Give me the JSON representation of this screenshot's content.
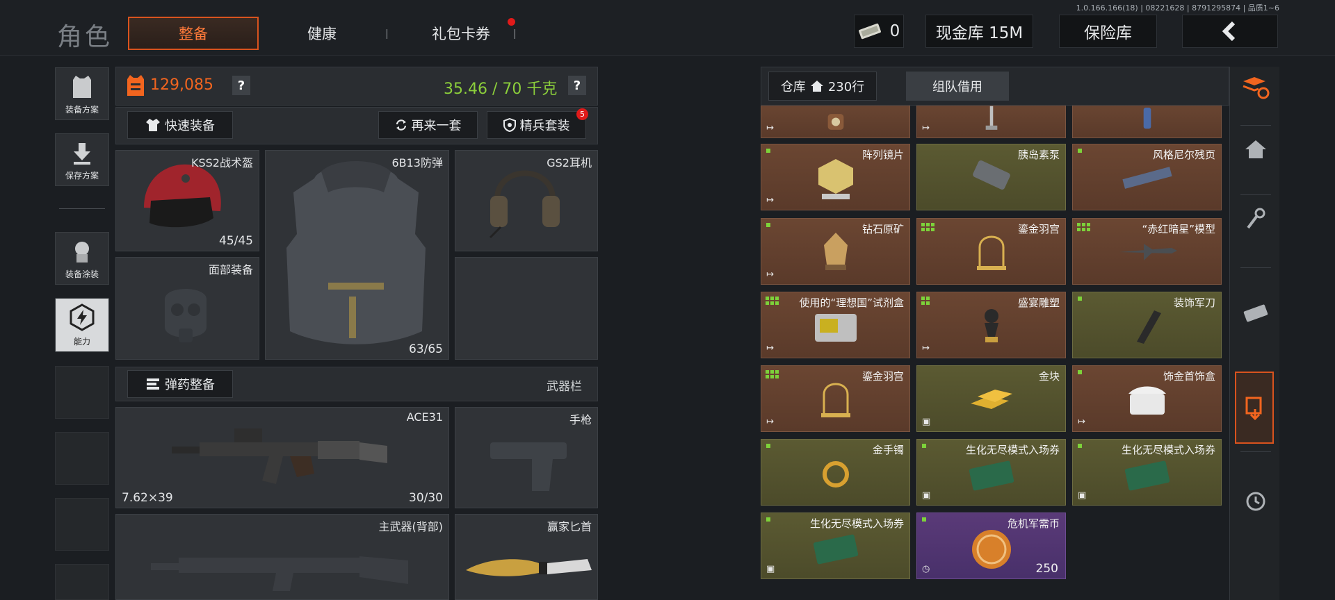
{
  "version": "1.0.166.166(18) | 08221628 | 8791295874 | 品质1~6",
  "header": {
    "title": "角色",
    "tabs": [
      {
        "label": "整备",
        "active": true
      },
      {
        "label": "健康",
        "active": false
      },
      {
        "label": "礼包卡券",
        "active": false,
        "badge": true
      }
    ],
    "currency_value": "0",
    "cash_vault": "现金库 15M",
    "insurance": "保险库",
    "back_icon": "chevron-left-icon"
  },
  "left_nav": [
    {
      "label": "装备方案",
      "icon": "vest-icon"
    },
    {
      "label": "保存方案",
      "icon": "download-icon"
    },
    {
      "label": "装备涂装",
      "icon": "skin-icon"
    },
    {
      "label": "能力",
      "icon": "ability-icon",
      "active": true
    }
  ],
  "stats": {
    "value": "129,085",
    "weight": "35.46 / 70 千克",
    "help": "?"
  },
  "actions": {
    "quick_equip": "快速装备",
    "again": "再来一套",
    "elite": "精兵套装",
    "elite_badge": "5"
  },
  "gear": {
    "helmet": {
      "label": "KSS2战术盔",
      "count": "45/45"
    },
    "armor": {
      "label": "6B13防弹",
      "count": "63/65"
    },
    "headset": {
      "label": "GS2耳机"
    },
    "face": {
      "label": "面部装备"
    }
  },
  "weapons": {
    "ammo_btn": "弹药整备",
    "section_label": "武器栏",
    "primary": {
      "label": "ACE31",
      "caliber": "7.62×39",
      "count": "30/30"
    },
    "pistol": {
      "label": "手枪"
    },
    "back_weapon": {
      "label": "主武器(背部)"
    },
    "knife": {
      "label": "赢家匕首"
    }
  },
  "storage": {
    "tab_vault": "仓库",
    "vault_rows": "230行",
    "tab_team": "组队借用",
    "items": [
      {
        "name": "",
        "color": "brown",
        "exit": true,
        "art": "clock-icon"
      },
      {
        "name": "",
        "color": "brown",
        "exit": true,
        "art": "lamp-icon"
      },
      {
        "name": "",
        "color": "brown",
        "exit": false,
        "art": "bottle-icon"
      },
      {
        "name": "阵列镜片",
        "color": "brown",
        "marker": "sq",
        "exit": true,
        "art": "lens-icon"
      },
      {
        "name": "胰岛素泵",
        "color": "olive",
        "marker": "",
        "exit": false,
        "art": "pump-icon"
      },
      {
        "name": "风格尼尔残页",
        "color": "brown",
        "marker": "sq",
        "exit": false,
        "art": "scroll-icon"
      },
      {
        "name": "钻石原矿",
        "color": "brown",
        "marker": "sq",
        "exit": true,
        "art": "ore-icon"
      },
      {
        "name": "鎏金羽宫",
        "color": "brown",
        "marker": "grid6",
        "exit": false,
        "art": "cage-icon"
      },
      {
        "name": "“赤红暗星”模型",
        "color": "brown",
        "marker": "grid6",
        "exit": false,
        "art": "jet-icon"
      },
      {
        "name": "使用的“理想国”试剂盒",
        "color": "brown",
        "marker": "grid6",
        "exit": true,
        "art": "kit-icon"
      },
      {
        "name": "盛宴雕塑",
        "color": "brown",
        "marker": "grid4",
        "exit": true,
        "art": "bust-icon"
      },
      {
        "name": "装饰军刀",
        "color": "olive",
        "marker": "sq",
        "exit": false,
        "art": "blade-icon"
      },
      {
        "name": "鎏金羽宫",
        "color": "brown",
        "marker": "grid6",
        "exit": true,
        "art": "cage-icon"
      },
      {
        "name": "金块",
        "color": "olive",
        "marker": "",
        "exit": false,
        "box": true,
        "art": "gold-icon"
      },
      {
        "name": "饰金首饰盒",
        "color": "brown",
        "marker": "sq",
        "exit": true,
        "art": "jewelry-box-icon"
      },
      {
        "name": "金手镯",
        "color": "olive",
        "marker": "sq",
        "exit": false,
        "art": "bracelet-icon"
      },
      {
        "name": "生化无尽模式入场券",
        "color": "olive",
        "marker": "sq",
        "exit": false,
        "box": true,
        "art": "ticket-icon"
      },
      {
        "name": "生化无尽模式入场券",
        "color": "olive",
        "marker": "sq",
        "exit": false,
        "box": true,
        "art": "ticket-icon"
      },
      {
        "name": "生化无尽模式入场券",
        "color": "olive",
        "marker": "sq",
        "exit": false,
        "box": true,
        "art": "ticket-icon"
      },
      {
        "name": "危机军需币",
        "color": "purple",
        "marker": "sq",
        "exit": false,
        "clock": true,
        "qty": "250",
        "art": "coin-icon"
      }
    ]
  },
  "right_bar": [
    "layers-refresh-icon",
    "home-icon",
    "key-icon",
    "cash-icon",
    "transfer-icon",
    "clock-icon"
  ]
}
